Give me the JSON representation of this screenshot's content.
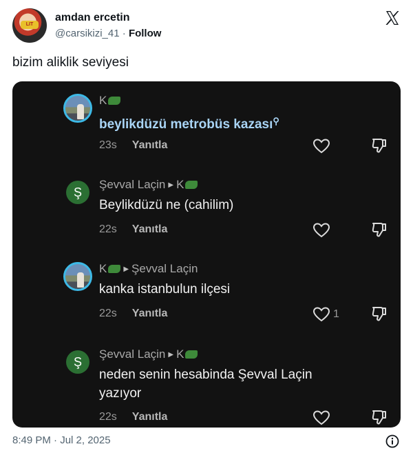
{
  "tweet": {
    "display_name": "amdan ercetin",
    "handle": "@carsikizi_41",
    "separator": "·",
    "follow_label": "Follow",
    "text": "bizim aliklik seviyesi",
    "timestamp": "8:49 PM · Jul 2, 2025",
    "avatar_text": "LIT"
  },
  "comments": [
    {
      "author": "K",
      "reply_to": "",
      "text": "beylikdüzü metrobüs kazası",
      "time": "23s",
      "reply_label": "Yanıtla",
      "likes": ""
    },
    {
      "author": "Şevval Laçin",
      "reply_to": "K",
      "avatar_letter": "Ş",
      "text": "Beylikdüzü ne (cahilim)",
      "time": "22s",
      "reply_label": "Yanıtla",
      "likes": ""
    },
    {
      "author": "K",
      "reply_to": "Şevval Laçin",
      "text": "kanka istanbulun ilçesi",
      "time": "22s",
      "reply_label": "Yanıtla",
      "likes": "1"
    },
    {
      "author": "Şevval Laçin",
      "reply_to": "K",
      "avatar_letter": "Ş",
      "text": "neden senin hesabinda Şevval Laçin yazıyor",
      "time": "22s",
      "reply_label": "Yanıtla",
      "likes": ""
    }
  ],
  "colors": {
    "media_bg": "#121212",
    "link_blue": "#a9d4f5",
    "avatar_ring": "#3db9e6",
    "s_avatar": "#2b6f33"
  }
}
